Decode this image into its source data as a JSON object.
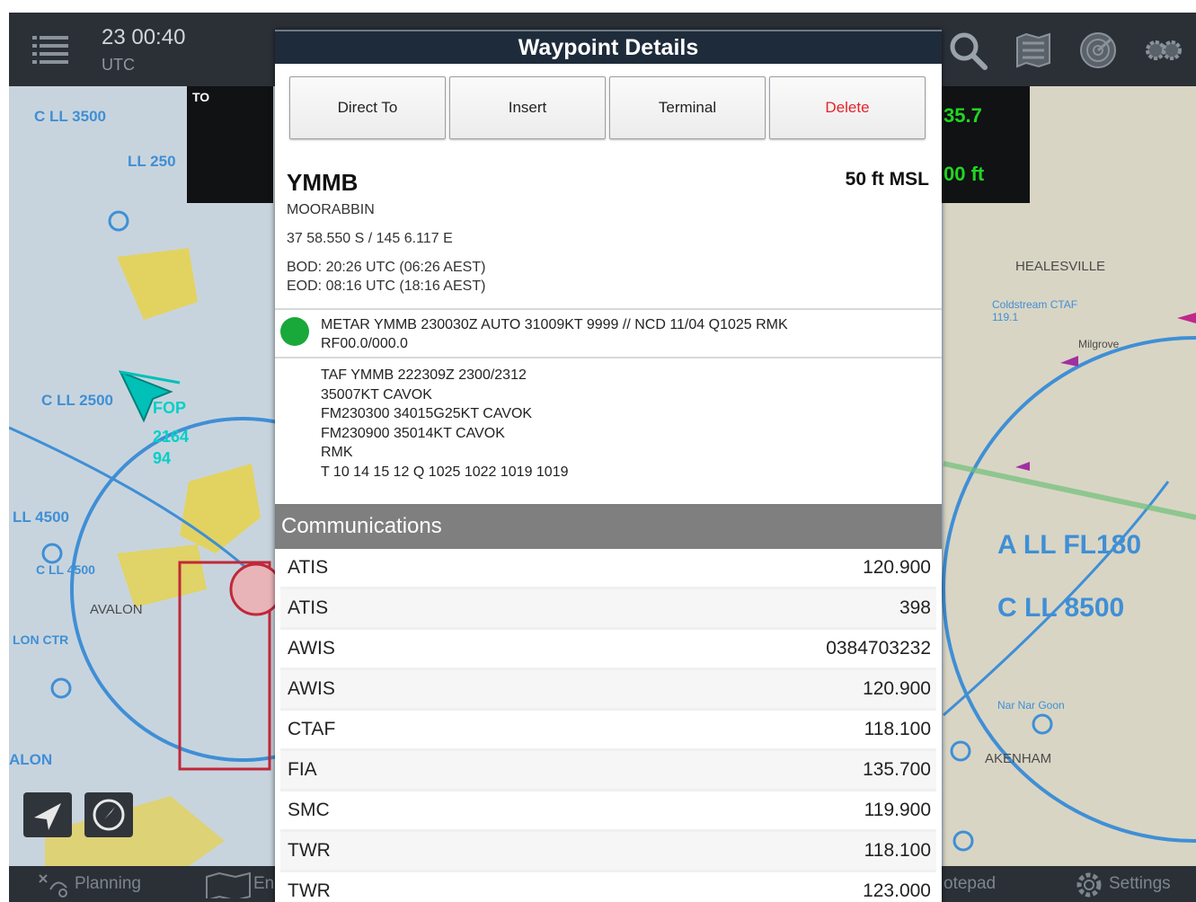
{
  "header": {
    "time": "23 00:40",
    "timezone": "UTC"
  },
  "status": {
    "to_label": "TO",
    "right_value_1": "35.7",
    "right_value_2": "00 ft"
  },
  "map": {
    "airspace_labels": [
      "C LL 3500",
      "C LL 2500",
      "C LL 2500",
      "LL 4500",
      "C LL 4500",
      "LON CTR",
      "ALON",
      "A LL FL180",
      "C LL 8500",
      "LL 250"
    ],
    "towns": [
      "HEALESVILLE",
      "Coldstream CTAF 119.1",
      "AKENHAM",
      "AVALON",
      "Milgrove",
      "Nar Nar Goon"
    ],
    "fop_label": "FOP",
    "fop_alt": "2164",
    "fop_sub": "94"
  },
  "dialog": {
    "title": "Waypoint Details",
    "buttons": {
      "direct_to": "Direct To",
      "insert": "Insert",
      "terminal": "Terminal",
      "delete": "Delete"
    },
    "waypoint": {
      "code": "YMMB",
      "elevation": "50 ft MSL",
      "name": "MOORABBIN",
      "coords": "37 58.550 S / 145 6.117 E",
      "bod": "BOD: 20:26 UTC (06:26 AEST)",
      "eod": "EOD: 08:16 UTC (18:16 AEST)"
    },
    "metar": {
      "status_color": "#19a83a",
      "line1": "METAR YMMB 230030Z AUTO 31009KT 9999 // NCD 11/04 Q1025 RMK",
      "line2": "RF00.0/000.0"
    },
    "taf": [
      "TAF YMMB 222309Z 2300/2312",
      "35007KT CAVOK",
      "FM230300 34015G25KT CAVOK",
      "FM230900 35014KT CAVOK",
      "RMK",
      "T 10 14 15 12 Q 1025 1022 1019 1019"
    ],
    "communications": {
      "header": "Communications",
      "rows": [
        {
          "type": "ATIS",
          "freq": "120.900"
        },
        {
          "type": "ATIS",
          "freq": "398"
        },
        {
          "type": "AWIS",
          "freq": "0384703232"
        },
        {
          "type": "AWIS",
          "freq": "120.900"
        },
        {
          "type": "CTAF",
          "freq": "118.100"
        },
        {
          "type": "FIA",
          "freq": "135.700"
        },
        {
          "type": "SMC",
          "freq": "119.900"
        },
        {
          "type": "TWR",
          "freq": "118.100"
        },
        {
          "type": "TWR",
          "freq": "123.000"
        }
      ]
    }
  },
  "bottombar": {
    "planning": "Planning",
    "en": "En",
    "notepad": "otepad",
    "settings": "Settings"
  },
  "colors": {
    "accent_delete": "#e8222a",
    "title_bar": "#1e2b3a",
    "comm_header": "#7f7f7f",
    "airspace": "#3f8fd6"
  }
}
